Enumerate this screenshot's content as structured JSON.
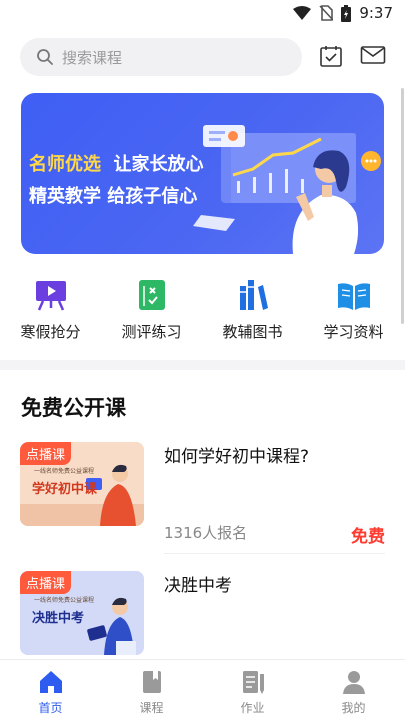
{
  "status_bar": {
    "time": "9:37",
    "icons": [
      "wifi-icon",
      "no-sim-icon",
      "battery-icon"
    ]
  },
  "header": {
    "search_placeholder": "搜索课程",
    "icons": [
      "calendar-check-icon",
      "mail-icon"
    ]
  },
  "banner": {
    "line1_highlight": "名师优选",
    "line1_rest": "让家长放心",
    "line2": "精英教学 给孩子信心"
  },
  "quick_nav": [
    {
      "label": "寒假抢分",
      "icon": "presentation-icon"
    },
    {
      "label": "测评练习",
      "icon": "exam-sheet-icon"
    },
    {
      "label": "教辅图书",
      "icon": "books-icon"
    },
    {
      "label": "学习资料",
      "icon": "open-book-icon"
    }
  ],
  "section": {
    "title": "免费公开课"
  },
  "courses": [
    {
      "badge": "点播课",
      "thumb_sub": "一线名师免费公益课程",
      "thumb_main": "学好初中课",
      "title": "如何学好初中课程?",
      "enroll": "1316人报名",
      "price": "免费"
    },
    {
      "badge": "点播课",
      "thumb_sub": "一线名师免费公益课程",
      "thumb_main": "决胜中考",
      "title": "决胜中考",
      "enroll": "",
      "price": ""
    }
  ],
  "tabbar": [
    {
      "label": "首页",
      "icon": "home-icon",
      "active": true
    },
    {
      "label": "课程",
      "icon": "course-icon",
      "active": false
    },
    {
      "label": "作业",
      "icon": "homework-icon",
      "active": false
    },
    {
      "label": "我的",
      "icon": "profile-icon",
      "active": false
    }
  ],
  "colors": {
    "accent": "#2f5cf0",
    "price": "#ff3b30",
    "badge": "#ff5a3c",
    "banner": "#4a66f2"
  }
}
